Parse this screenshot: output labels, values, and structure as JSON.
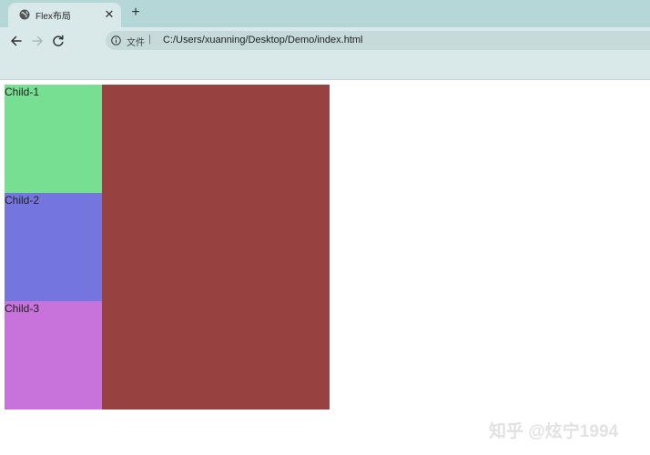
{
  "tab": {
    "title": "Flex布局",
    "close_glyph": "✕",
    "favicon": "globe-icon"
  },
  "new_tab_glyph": "+",
  "toolbar": {
    "back": "arrow-left-icon",
    "forward": "arrow-right-icon",
    "reload": "reload-icon"
  },
  "address_bar": {
    "scheme_label": "文件",
    "separator": "|",
    "url": "C:/Users/xuanning/Desktop/Demo/index.html"
  },
  "page": {
    "children": [
      {
        "label": "Child-1",
        "color": "#76df91"
      },
      {
        "label": "Child-2",
        "color": "#7575df"
      },
      {
        "label": "Child-3",
        "color": "#c872dc"
      }
    ],
    "main_color": "#974240"
  },
  "watermark": "知乎 @炫宁1994",
  "colors": {
    "tabbar": "#b5d7d7",
    "toolbar": "#d9e8e8",
    "omnibox": "#c7dada"
  }
}
